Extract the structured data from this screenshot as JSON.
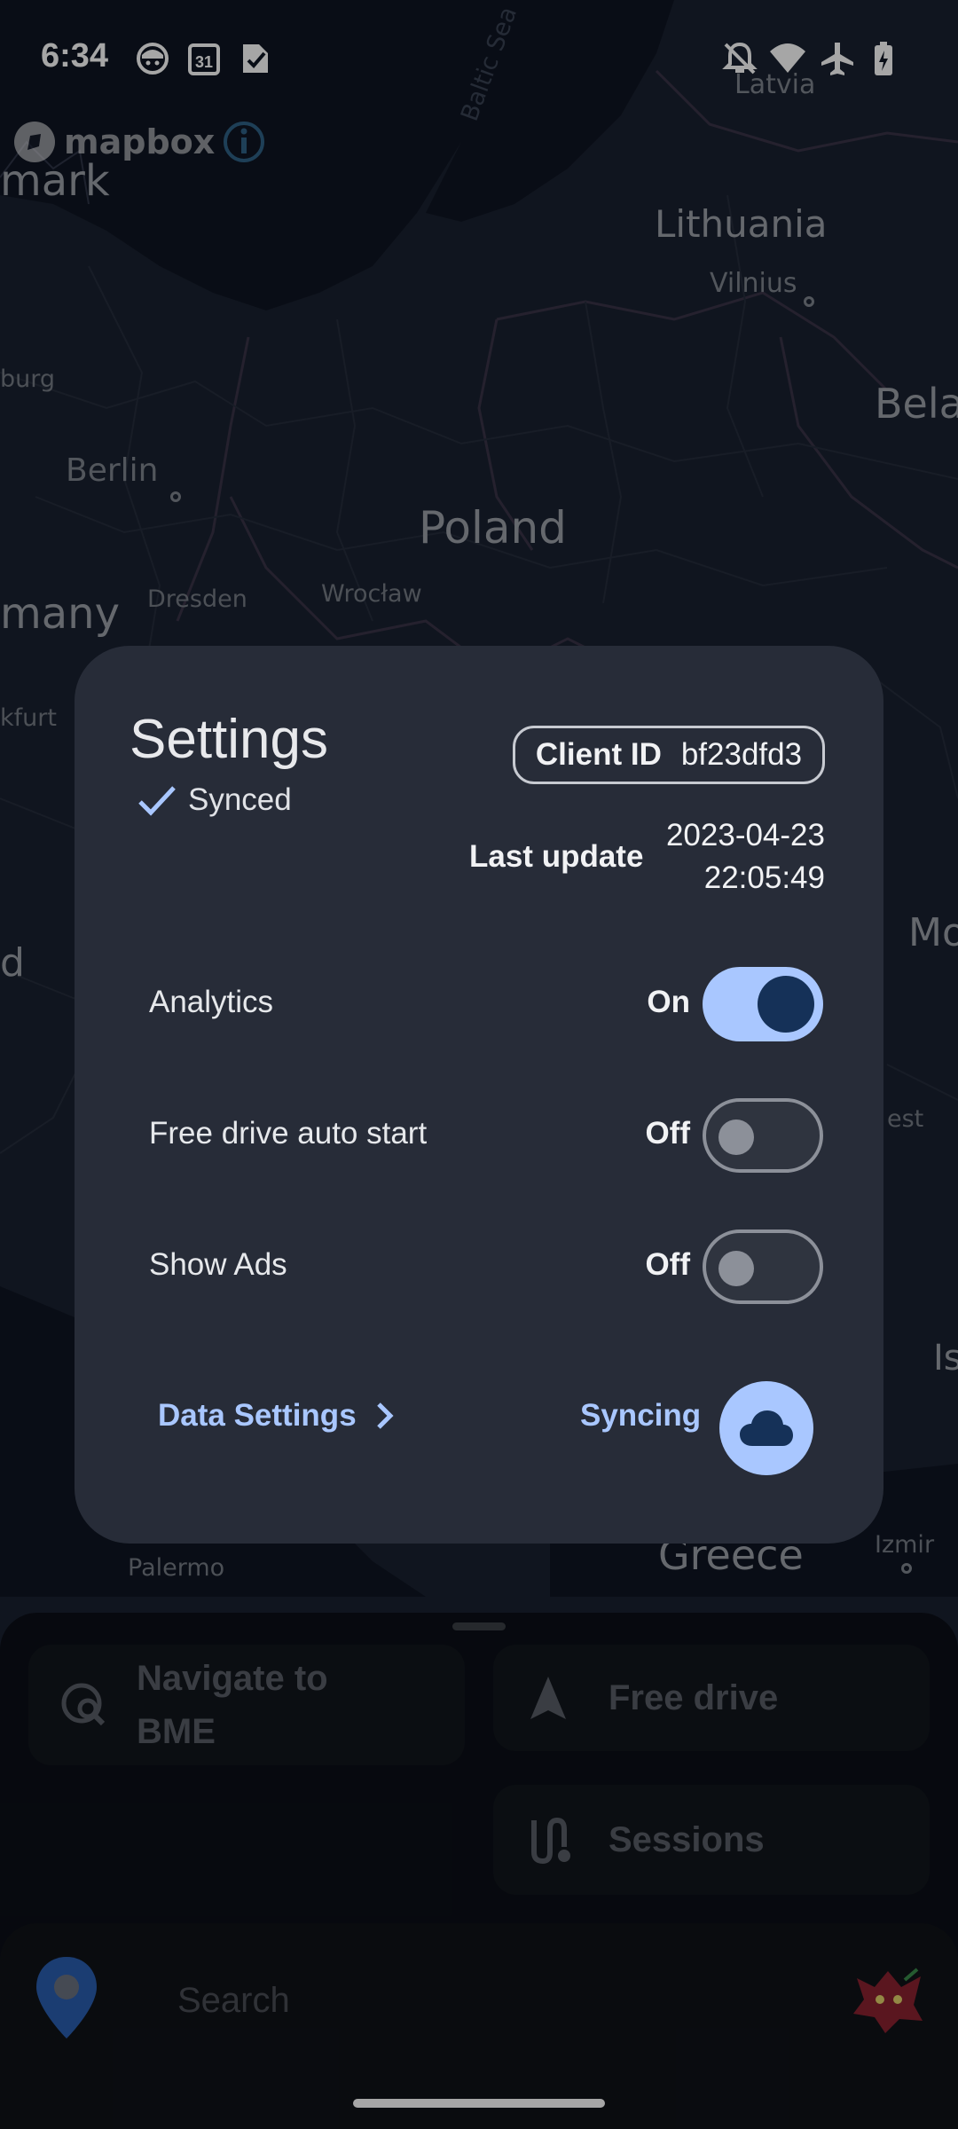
{
  "status_bar": {
    "time": "6:34",
    "icons": [
      "face-notification-icon",
      "calendar-icon",
      "task-check-icon",
      "notifications-off-icon",
      "wifi-icon",
      "airplane-mode-icon",
      "battery-charging-icon"
    ],
    "calendar_day": "31"
  },
  "map": {
    "attribution": "mapbox",
    "labels": {
      "latvia": "Latvia",
      "lithuania": "Lithuania",
      "vilnius": "Vilnius",
      "poland": "Poland",
      "berlin": "Berlin",
      "dresden": "Dresden",
      "wroclaw": "Wrocław",
      "baltic_sea": "Baltic Sea",
      "greece": "Greece",
      "izmir": "Izmir",
      "palermo": "Palermo",
      "mark": "mark",
      "many": "many",
      "burg": "burg",
      "kfurt": "kfurt",
      "bela": "Bela",
      "mo": "Mo",
      "est": "est",
      "is": "Is",
      "d": "d"
    }
  },
  "settings": {
    "title": "Settings",
    "sync_status": "Synced",
    "client_id_label": "Client ID",
    "client_id_value": "bf23dfd3",
    "last_update_label": "Last update",
    "last_update_date": "2023-04-23",
    "last_update_time": "22:05:49",
    "rows": [
      {
        "name": "Analytics",
        "state": "On",
        "enabled": true
      },
      {
        "name": "Free drive auto start",
        "state": "Off",
        "enabled": false
      },
      {
        "name": "Show Ads",
        "state": "Off",
        "enabled": false
      }
    ],
    "data_settings_label": "Data Settings",
    "syncing_label": "Syncing"
  },
  "bottom_sheet": {
    "navigate_label_line1": "Navigate to",
    "navigate_label_line2": "BME",
    "free_drive_label": "Free drive",
    "sessions_label": "Sessions",
    "search_placeholder": "Search"
  },
  "colors": {
    "accent": "#a9c7ff",
    "dialog_bg": "#272c38",
    "map_bg": "#0f1624"
  }
}
